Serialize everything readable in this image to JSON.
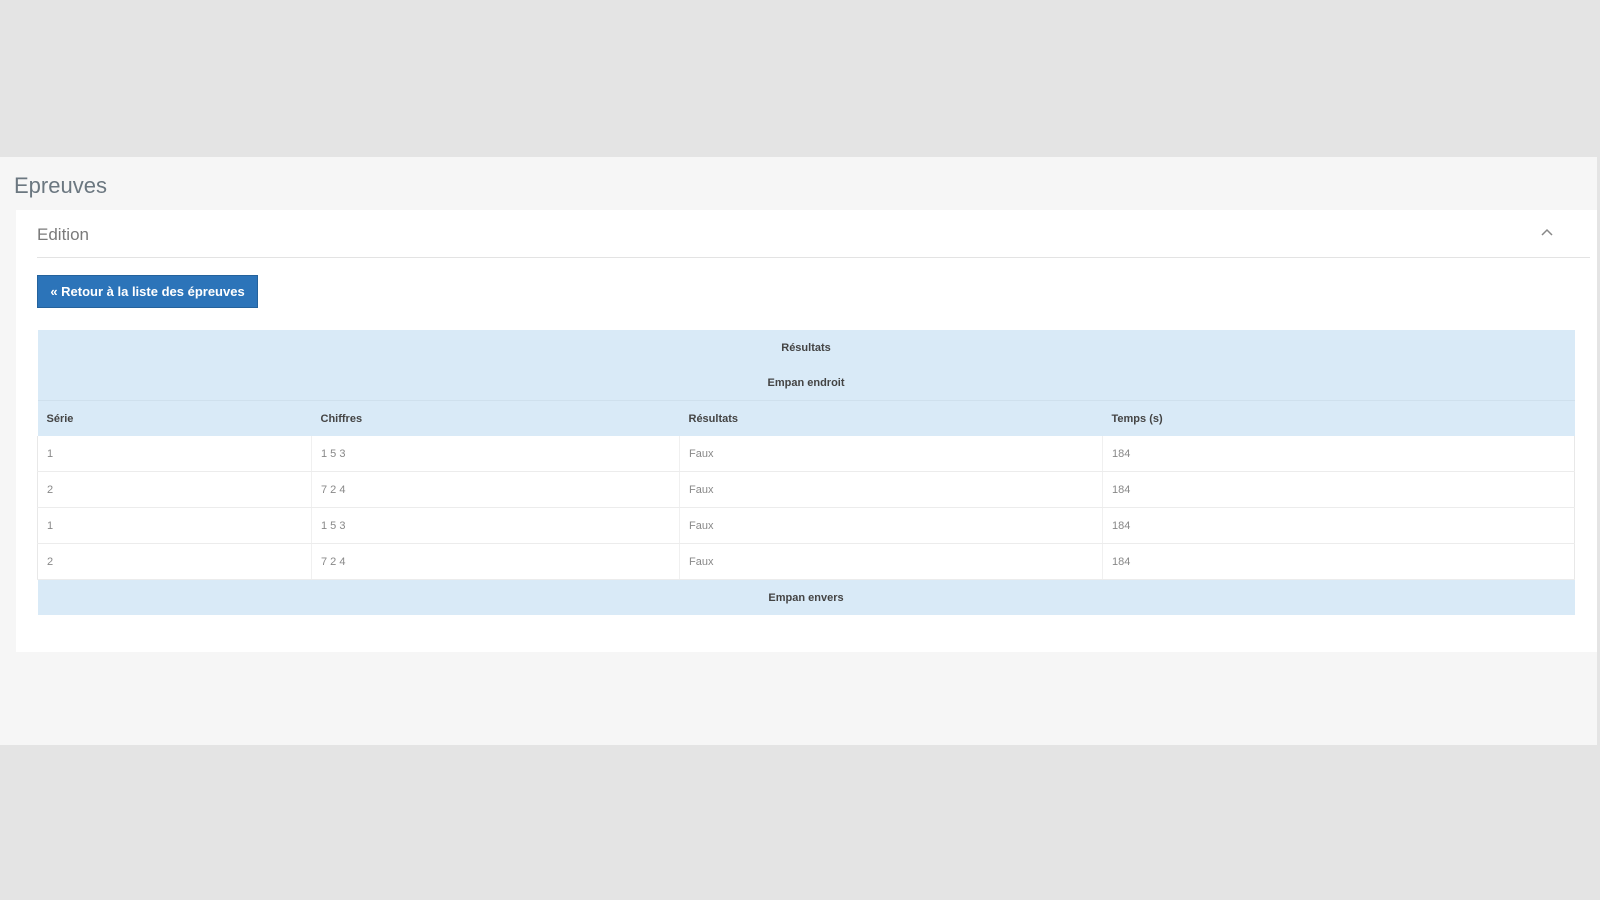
{
  "page": {
    "title": "Epreuves"
  },
  "panel": {
    "title": "Edition",
    "collapse_icon": "chevron-up-icon",
    "back_button_label": "« Retour à la liste des épreuves"
  },
  "table": {
    "caption": "Résultats",
    "section_title": "Empan endroit",
    "columns": [
      "Série",
      "Chiffres",
      "Résultats",
      "Temps (s)"
    ],
    "rows": [
      [
        "1",
        "1 5 3",
        "Faux",
        "184"
      ],
      [
        "2",
        "7 2 4",
        "Faux",
        "184"
      ],
      [
        "1",
        "1 5 3",
        "Faux",
        "184"
      ],
      [
        "2",
        "7 2 4",
        "Faux",
        "184"
      ]
    ],
    "footer_section_title": "Empan envers"
  },
  "colors": {
    "background": "#e4e4e4",
    "content_background": "#f6f6f6",
    "accent_button": "#2c74b9",
    "table_header": "#d9eaf7"
  }
}
